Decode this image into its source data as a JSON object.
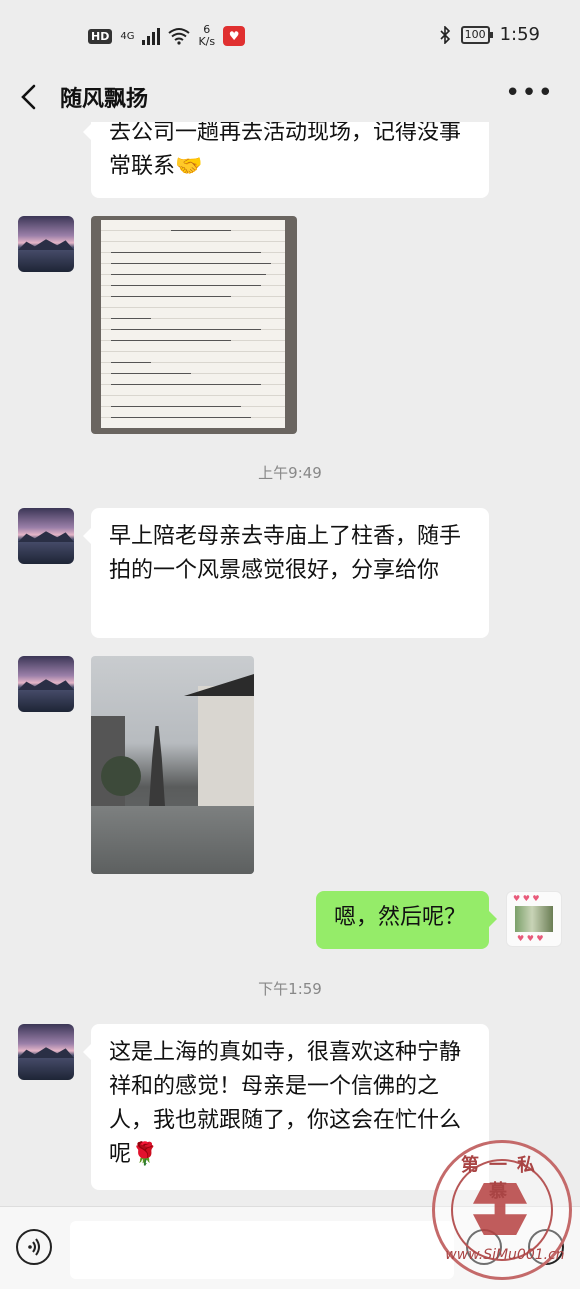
{
  "status_bar": {
    "hd_label": "HD",
    "network": "4G",
    "speed_value": "6",
    "speed_unit": "K/s",
    "battery": "100",
    "time": "1:59"
  },
  "header": {
    "title": "随风飘扬"
  },
  "messages": {
    "m0_partial": "去公司一趟再去活动现场，记得没事常联系🤝",
    "time1": "上午9:49",
    "m2": "早上陪老母亲去寺庙上了柱香，随手拍的一个风景感觉很好，分享给你",
    "m4_self": "嗯，然后呢？",
    "time2": "下午1:59",
    "m5": "这是上海的真如寺，很喜欢这种宁静祥和的感觉！母亲是一个信佛的之人，我也就跟随了，你这会在忙什么呢🌹"
  },
  "input": {
    "placeholder": ""
  },
  "watermark": {
    "top_text": "第一私慕",
    "bottom_text": "www.SiMu001.cn"
  },
  "icons": [
    "back-arrow-icon",
    "more-icon",
    "voice-icon",
    "emoji-icon",
    "plus-icon",
    "bluetooth-icon",
    "wifi-icon",
    "battery-icon"
  ]
}
